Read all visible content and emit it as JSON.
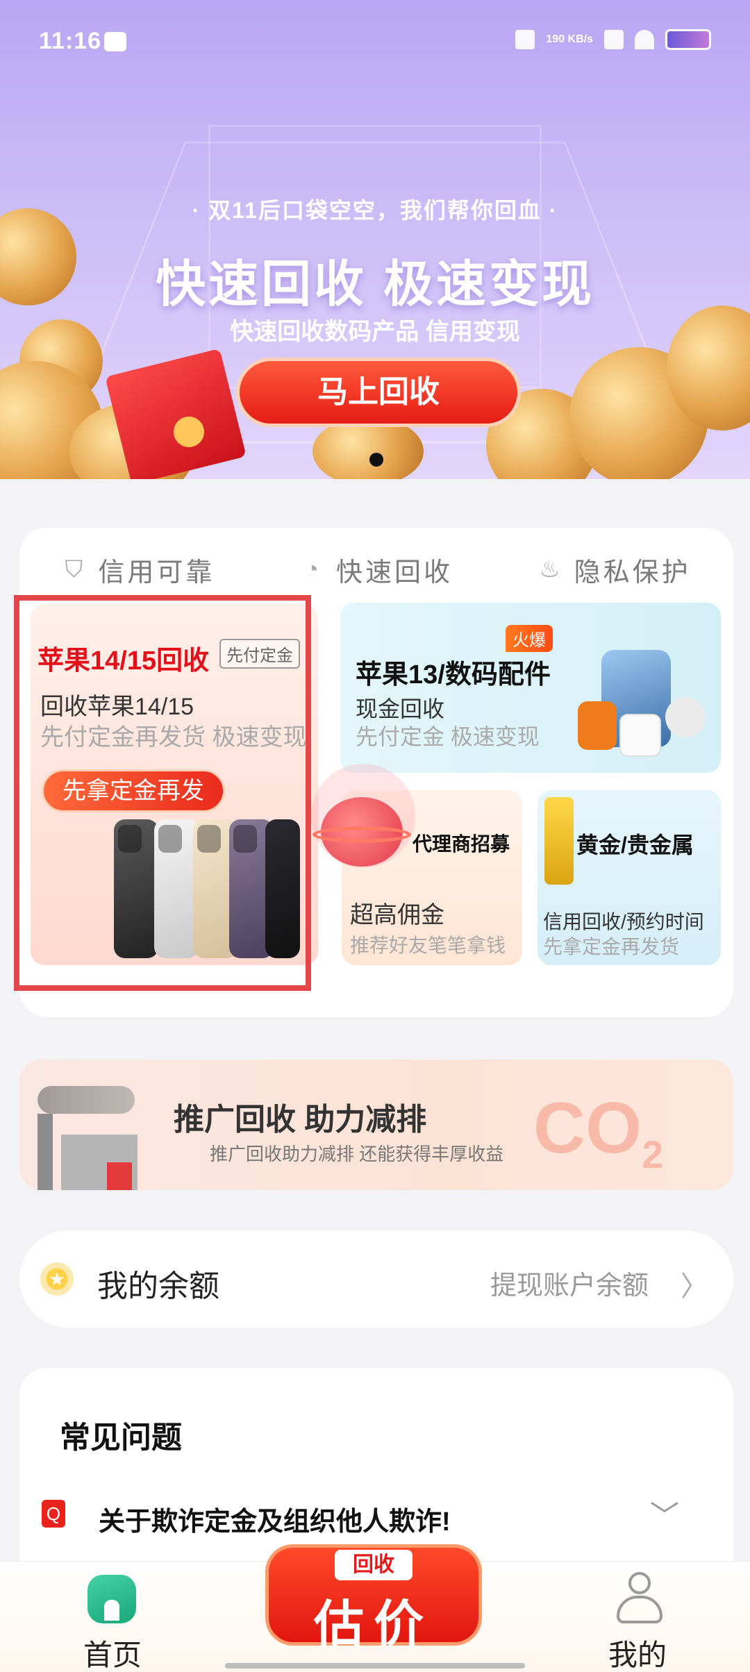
{
  "status_bar": {
    "time": "11:16",
    "net_speed": "190 KB/s"
  },
  "banner": {
    "tag": "· 双11后口袋空空，我们帮你回血 ·",
    "title": "快速回收 极速变现",
    "subtitle": "快速回收数码产品 信用变现",
    "button": "马上回收",
    "page_index": 1
  },
  "features": [
    {
      "icon": "shield-check-icon",
      "label": "信用可靠"
    },
    {
      "icon": "refresh-icon",
      "label": "快速回收"
    },
    {
      "icon": "flame-icon",
      "label": "隐私保护"
    }
  ],
  "tiles": {
    "apple15": {
      "title": "苹果14/15回收",
      "badge": "先付定金",
      "line1": "回收苹果14/15",
      "line2": "先付定金再发货 极速变现",
      "button": "先拿定金再发"
    },
    "apple13": {
      "hot": "火爆",
      "title": "苹果13/数码配件",
      "line1": "现金回收",
      "line2": "先付定金 极速变现"
    },
    "agent": {
      "title": "代理商招募",
      "line1": "超高佣金",
      "line2": "推荐好友笔笔拿钱"
    },
    "gold": {
      "title": "黄金/贵金属",
      "line1": "信用回收/预约时间",
      "line2": "先拿定金再发货"
    }
  },
  "promo": {
    "title": "推广回收 助力减排",
    "subtitle": "推广回收助力减排 还能获得丰厚收益",
    "co2": "CO",
    "co2_sub": "2"
  },
  "balance": {
    "label": "我的余额",
    "action": "提现账户余额"
  },
  "faq": {
    "title": "常见问题",
    "items": [
      {
        "icon": "Q",
        "text": "关于欺诈定金及组织他人欺诈!"
      }
    ]
  },
  "nav": {
    "home": "首页",
    "fab_tag": "回收",
    "fab": "估价",
    "me": "我的"
  },
  "colors": {
    "accent_red": "#e3101a",
    "home_green": "#1aa77a",
    "highlight": "#e4474a"
  }
}
